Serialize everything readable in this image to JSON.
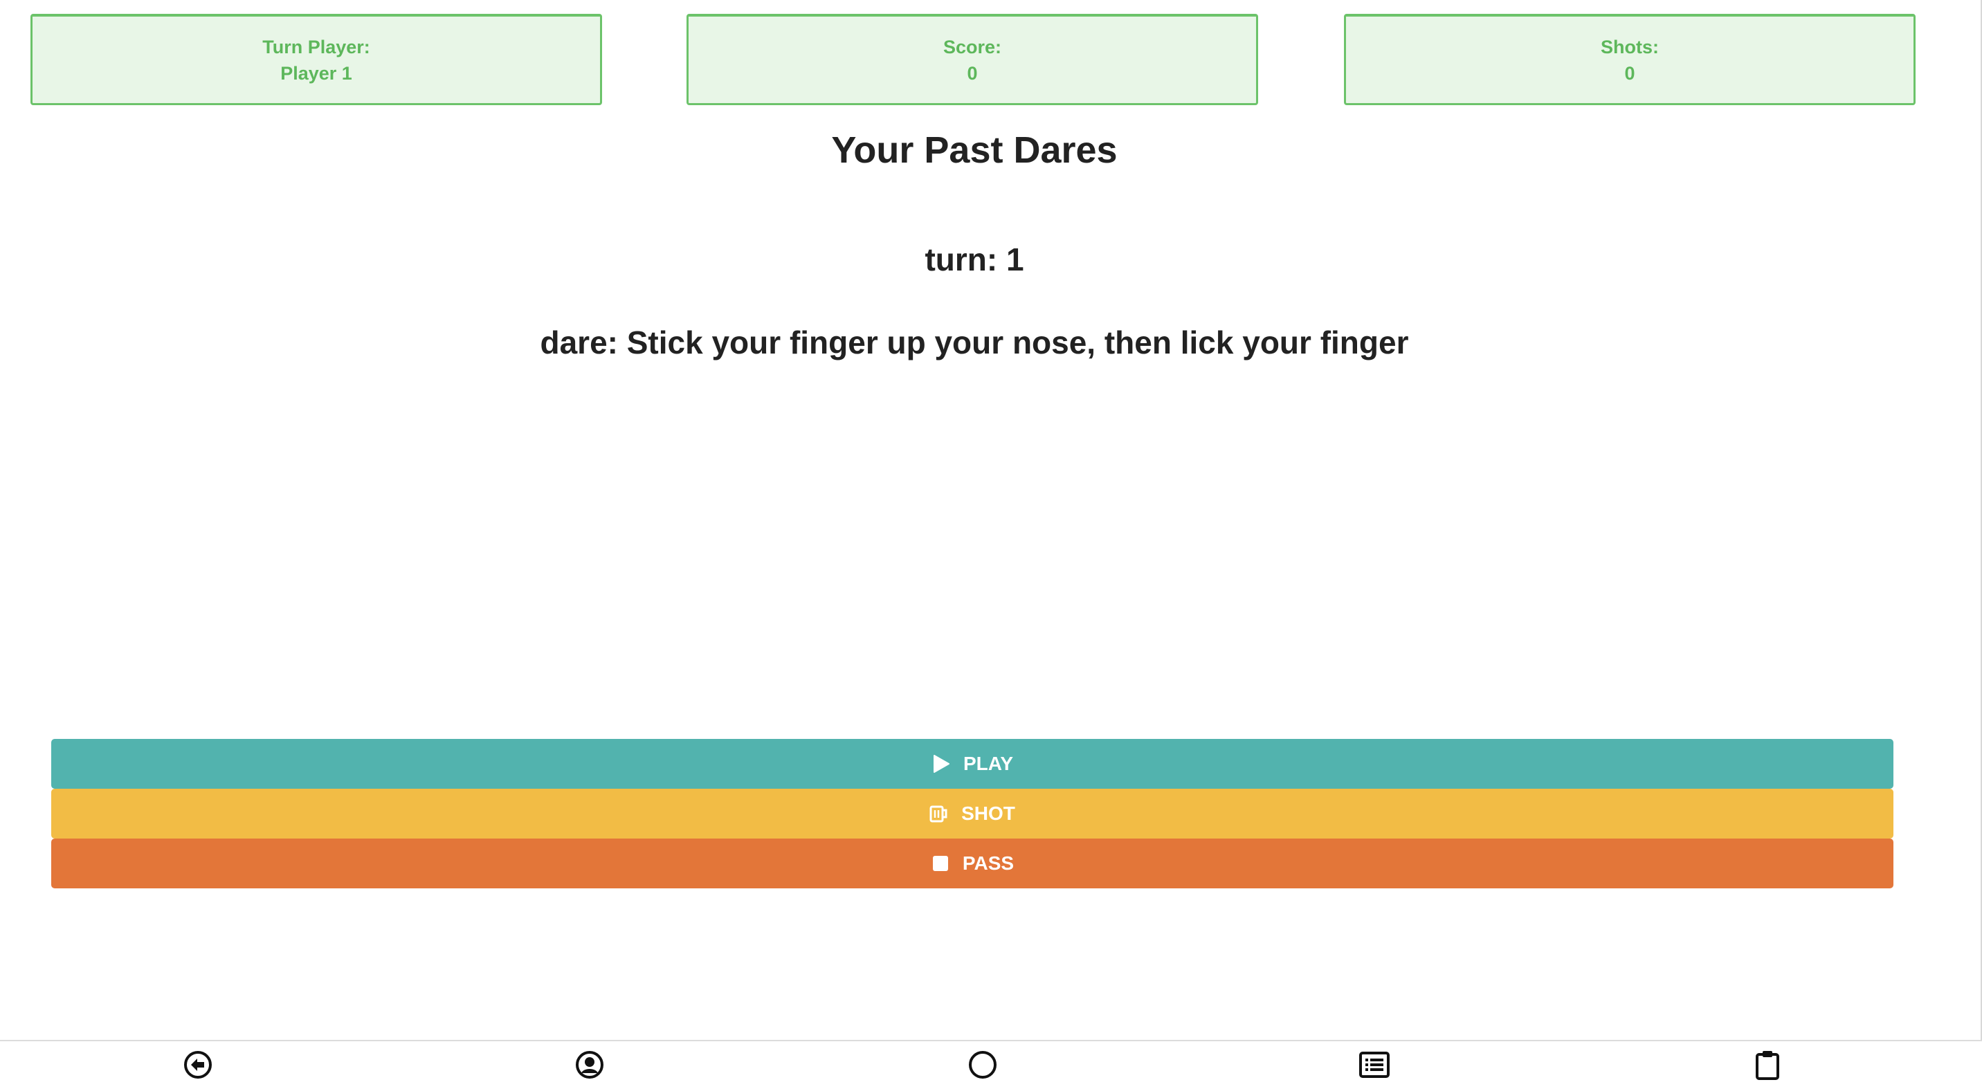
{
  "stats": {
    "turn_player_label": "Turn Player:",
    "turn_player_value": "Player 1",
    "score_label": "Score:",
    "score_value": "0",
    "shots_label": "Shots:",
    "shots_value": "0"
  },
  "main": {
    "title": "Your Past Dares",
    "turn_text": "turn: 1",
    "dare_text": "dare: Stick your finger up your nose, then lick your finger"
  },
  "actions": {
    "play": {
      "label": "PLAY",
      "icon": "play-icon",
      "color": "#52b3ae"
    },
    "shot": {
      "label": "SHOT",
      "icon": "beer-mug-icon",
      "color": "#f2bc45"
    },
    "pass": {
      "label": "PASS",
      "icon": "stop-icon",
      "color": "#e37639"
    }
  },
  "bottom_nav": {
    "items": [
      {
        "icon": "back-arrow-circle-icon"
      },
      {
        "icon": "user-circle-icon"
      },
      {
        "icon": "circle-icon"
      },
      {
        "icon": "list-icon"
      },
      {
        "icon": "clipboard-icon"
      }
    ]
  },
  "theme": {
    "stat_bg": "#e8f6e7",
    "stat_border": "#6cc36a",
    "stat_text": "#5db75b"
  }
}
